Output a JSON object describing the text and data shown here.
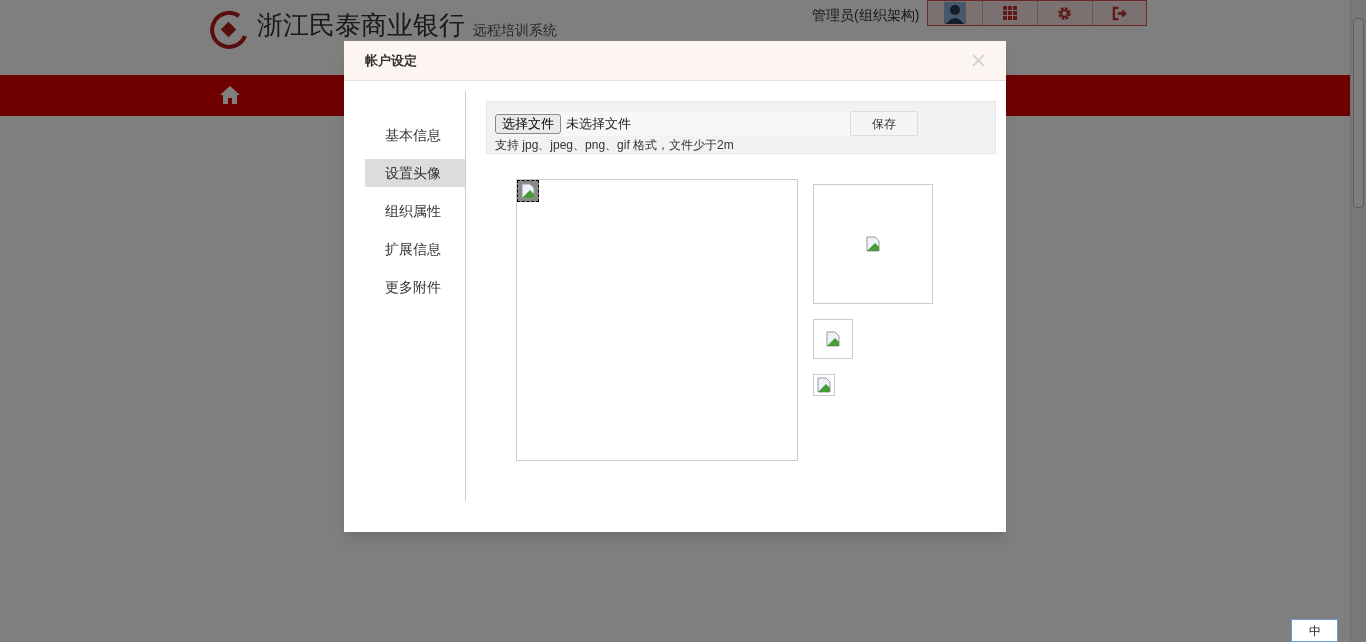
{
  "header": {
    "bank_name": "浙江民泰商业银行",
    "subtitle": "远程培训系统",
    "user_label": "管理员(组织架构)"
  },
  "modal": {
    "title": "帐户设定",
    "menu": [
      {
        "label": "基本信息",
        "selected": false
      },
      {
        "label": "设置头像",
        "selected": true
      },
      {
        "label": "组织属性",
        "selected": false
      },
      {
        "label": "扩展信息",
        "selected": false
      },
      {
        "label": "更多附件",
        "selected": false
      }
    ],
    "upload": {
      "choose_button": "选择文件",
      "file_status": "未选择文件",
      "save_button": "保存",
      "hint": "支持 jpg、jpeg、png、gif 格式，文件少于2m"
    }
  },
  "ime": {
    "label": "中"
  }
}
